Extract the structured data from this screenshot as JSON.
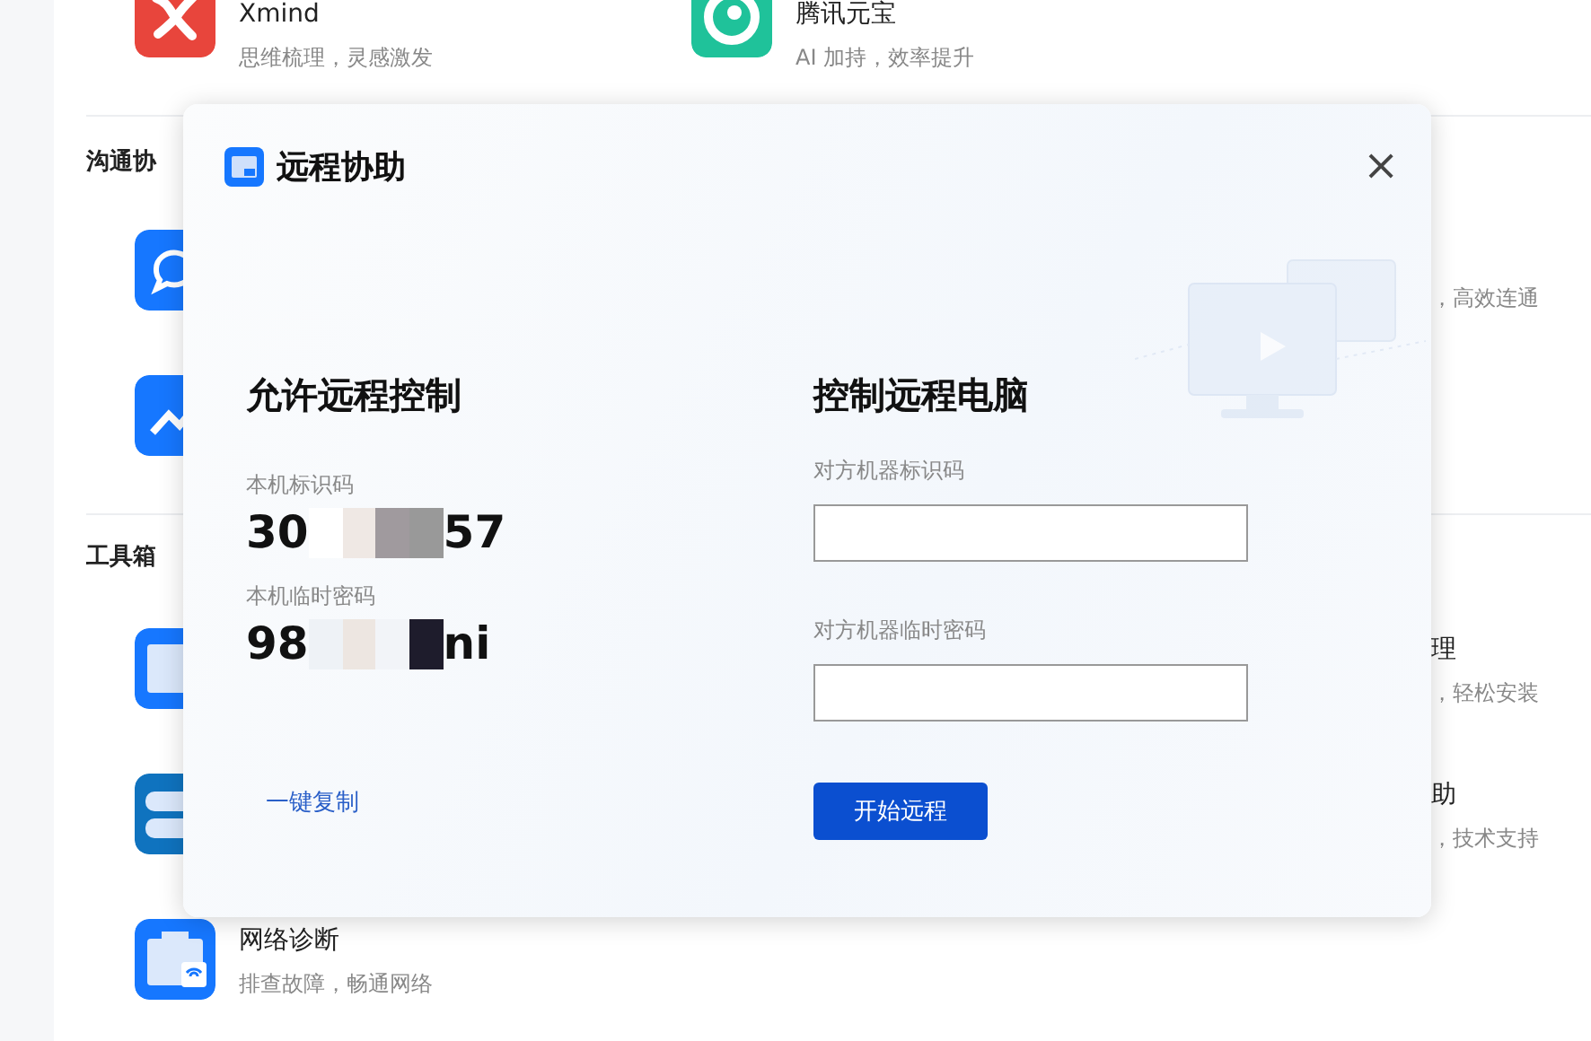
{
  "top_apps": [
    {
      "kind": "xmind",
      "title": "Xmind",
      "subtitle": "思维梳理，灵感激发"
    },
    {
      "kind": "yuanbao",
      "title": "腾讯元宝",
      "subtitle": "AI 加持，效率提升"
    }
  ],
  "sections": [
    {
      "title": "沟通协",
      "rows": [
        {
          "kind": "chat",
          "right": {
            "subtitle": "，高效连通"
          }
        },
        {
          "kind": "meeting"
        }
      ]
    },
    {
      "title": "工具箱",
      "rows": [
        {
          "kind": "window",
          "right": {
            "title": "理",
            "subtitle": "，轻松安装"
          }
        },
        {
          "kind": "server",
          "right": {
            "title": "助",
            "subtitle": "，技术支持"
          }
        },
        {
          "kind": "network",
          "title": "网络诊断",
          "subtitle": "排查故障，畅通网络"
        }
      ]
    }
  ],
  "dialog": {
    "title": "远程协助",
    "close": "×",
    "allow": {
      "heading": "允许远程控制",
      "id_label": "本机标识码",
      "id_start": "30",
      "id_end": "57",
      "password_label": "本机临时密码",
      "password_start": "98",
      "password_end": "ni",
      "copy_link": "一键复制"
    },
    "control": {
      "heading": "控制远程电脑",
      "id_label": "对方机器标识码",
      "password_label": "对方机器临时密码",
      "start_button": "开始远程"
    }
  }
}
